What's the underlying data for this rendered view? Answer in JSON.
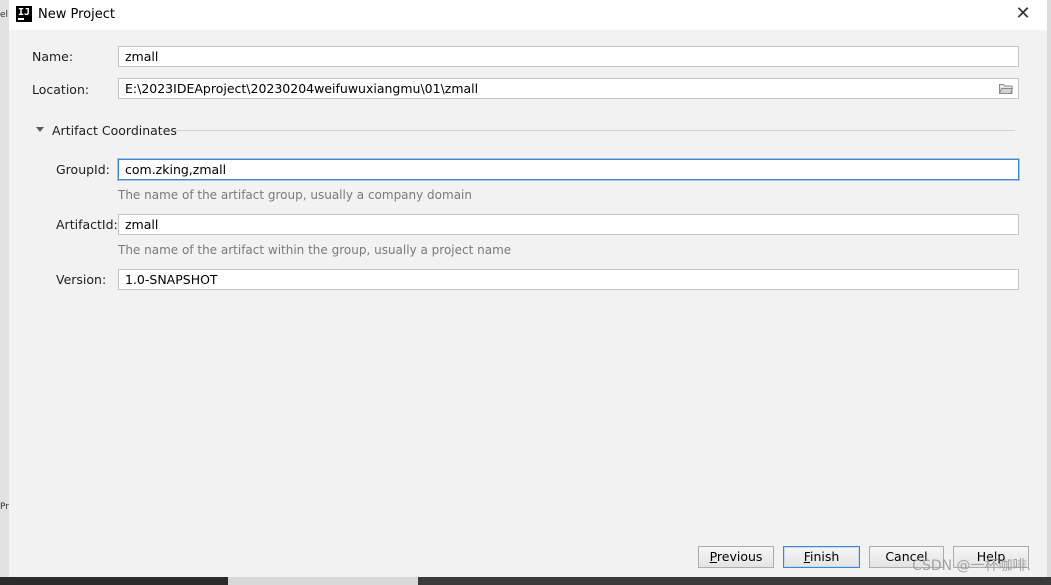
{
  "window": {
    "title": "New Project",
    "logo_text": "IJ"
  },
  "form": {
    "name_label": "Name:",
    "name_value": "zmall",
    "location_label": "Location:",
    "location_value": "E:\\2023IDEAproject\\20230204weifuwuxiangmu\\01\\zmall"
  },
  "artifact": {
    "section_title": "Artifact Coordinates",
    "groupid_label": "GroupId:",
    "groupid_value": "com.zking,zmall",
    "groupid_hint": "The name of the artifact group, usually a company domain",
    "artifactid_label": "ArtifactId:",
    "artifactid_value": "zmall",
    "artifactid_hint": "The name of the artifact within the group, usually a project name",
    "version_label": "Version:",
    "version_value": "1.0-SNAPSHOT"
  },
  "buttons": {
    "previous_mnemonic": "P",
    "previous_rest": "revious",
    "finish_mnemonic": "F",
    "finish_rest": "inish",
    "cancel": "Cancel",
    "help": "Help"
  },
  "watermark": "CSDN @一杯咖啡.",
  "background_fragments": [
    "el",
    "Pr"
  ],
  "icons": [
    "intellij-logo-icon",
    "close-icon",
    "folder-icon",
    "triangle-down-icon"
  ]
}
